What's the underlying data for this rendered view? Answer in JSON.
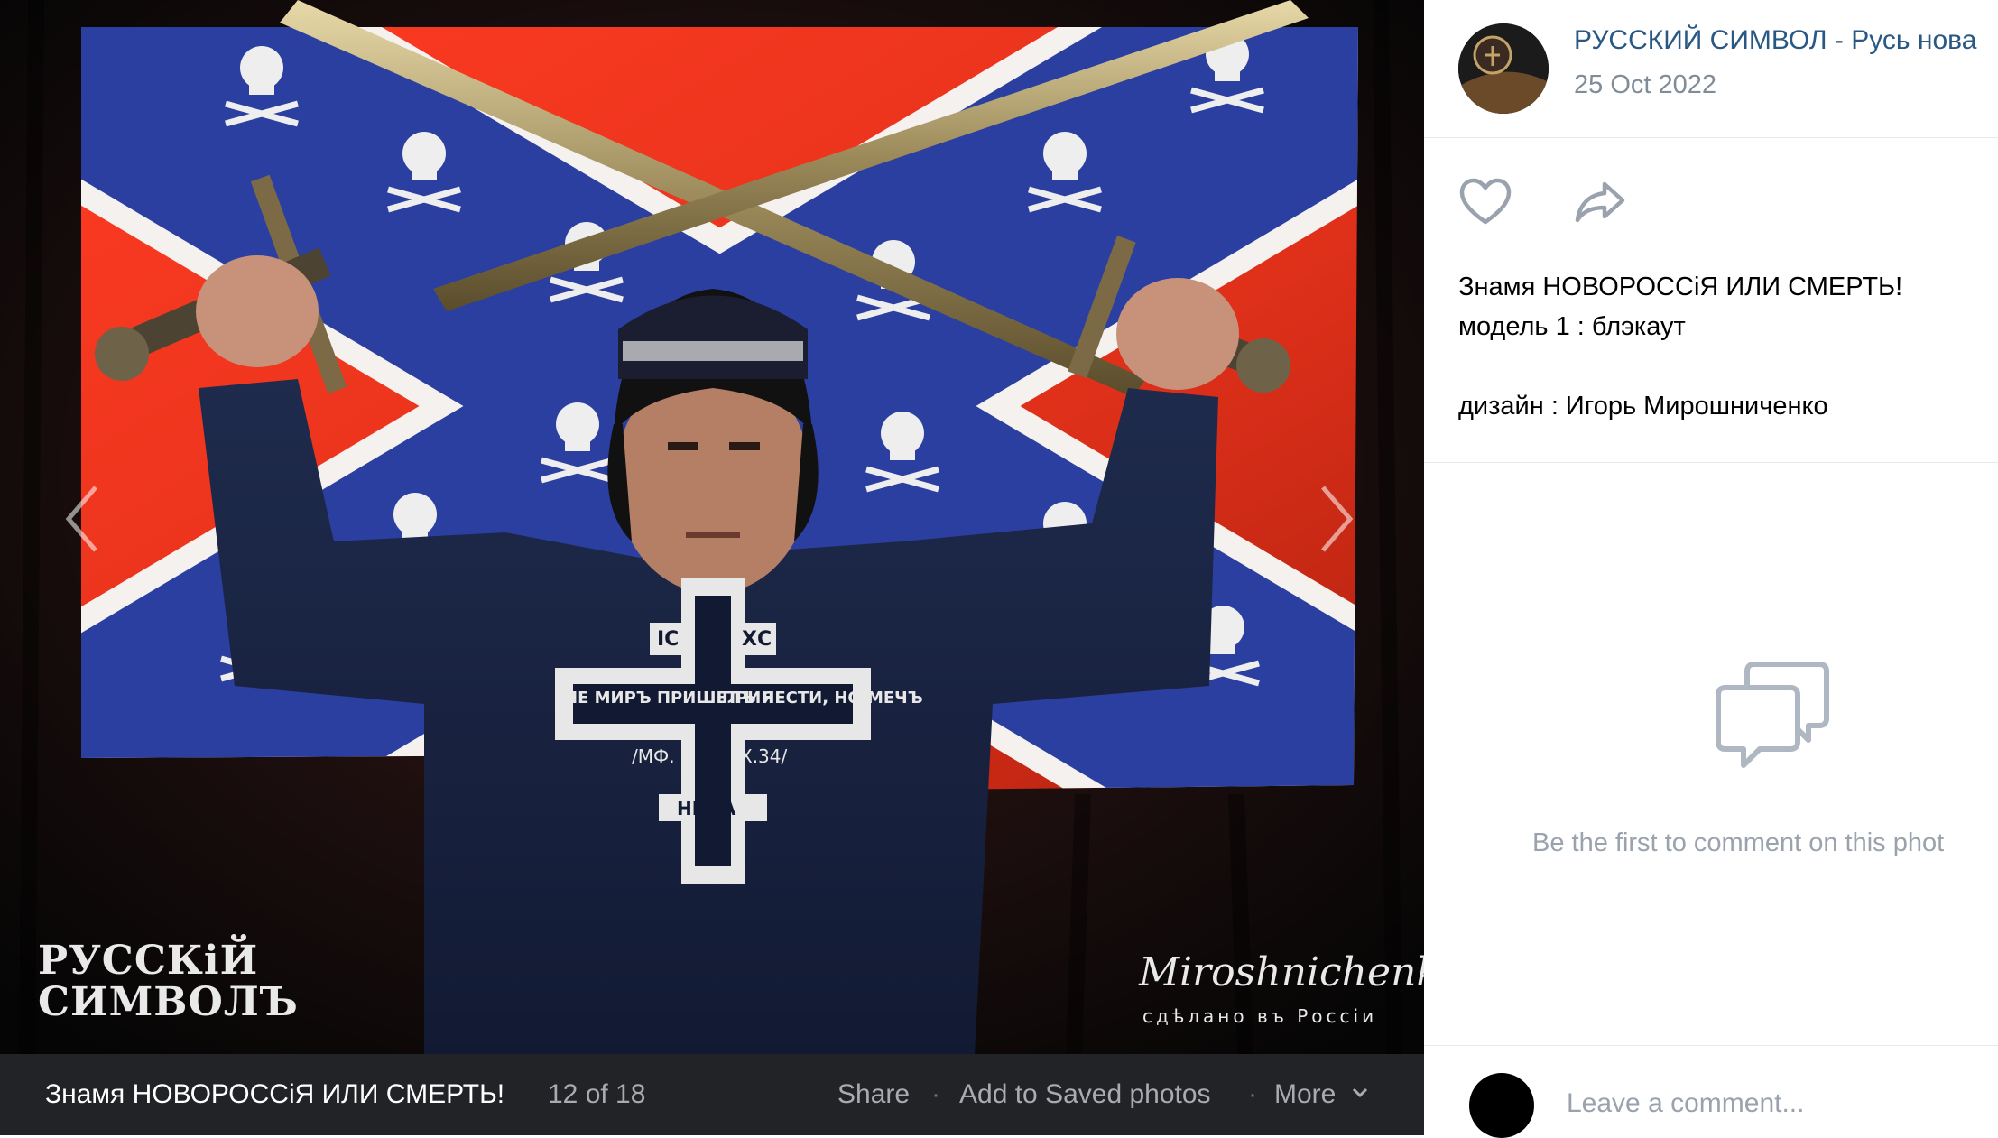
{
  "viewer": {
    "caption_title": "Знамя НОВОРОССіЯ ИЛИ СМЕРТЬ!",
    "counter": "12 of 18",
    "actions": {
      "share": "Share",
      "separator": "·",
      "save": "Add to Saved photos",
      "more": "More"
    },
    "icons": {
      "prev": "chevron-left-icon",
      "next": "chevron-right-icon",
      "more": "chevron-down-icon"
    },
    "photo": {
      "watermark_left_line1": "РУССКіЙ",
      "watermark_left_line2": "СИМВОЛЪ",
      "watermark_right": "Miroshnichenko",
      "watermark_right_sub": "сдѣлано въ Россіи",
      "shirt_text_left": "НЕ МИРЪ ПРИШЕЛЪ Я",
      "shirt_text_right": "ПРИНЕСТИ, НО МЕЧЪ",
      "shirt_text_top_left": "ІС",
      "shirt_text_top_right": "ХС",
      "shirt_text_bottom": "НИКА",
      "shirt_ref_left": "/МФ.",
      "shirt_ref_right": "Х.34/"
    }
  },
  "post": {
    "group_name": "РУССКИЙ СИМВОЛ - Русь нова",
    "date": "25 Oct 2022",
    "description": [
      "Знамя НОВОРОССіЯ ИЛИ СМЕРТЬ!",
      "модель 1 : блэкаут",
      "",
      "дизайн : Игорь Мирошниченко"
    ],
    "icons": {
      "like": "heart-icon",
      "repost": "share-arrow-icon",
      "comments": "comments-icon"
    }
  },
  "comments": {
    "empty_text": "Be the first to comment on this phot",
    "input_placeholder": "Leave a comment..."
  },
  "colors": {
    "link": "#2a5885",
    "muted": "#818c99",
    "flag_red": "#e8341c",
    "flag_blue": "#2a3f9e",
    "caption_bar": "#222326"
  }
}
